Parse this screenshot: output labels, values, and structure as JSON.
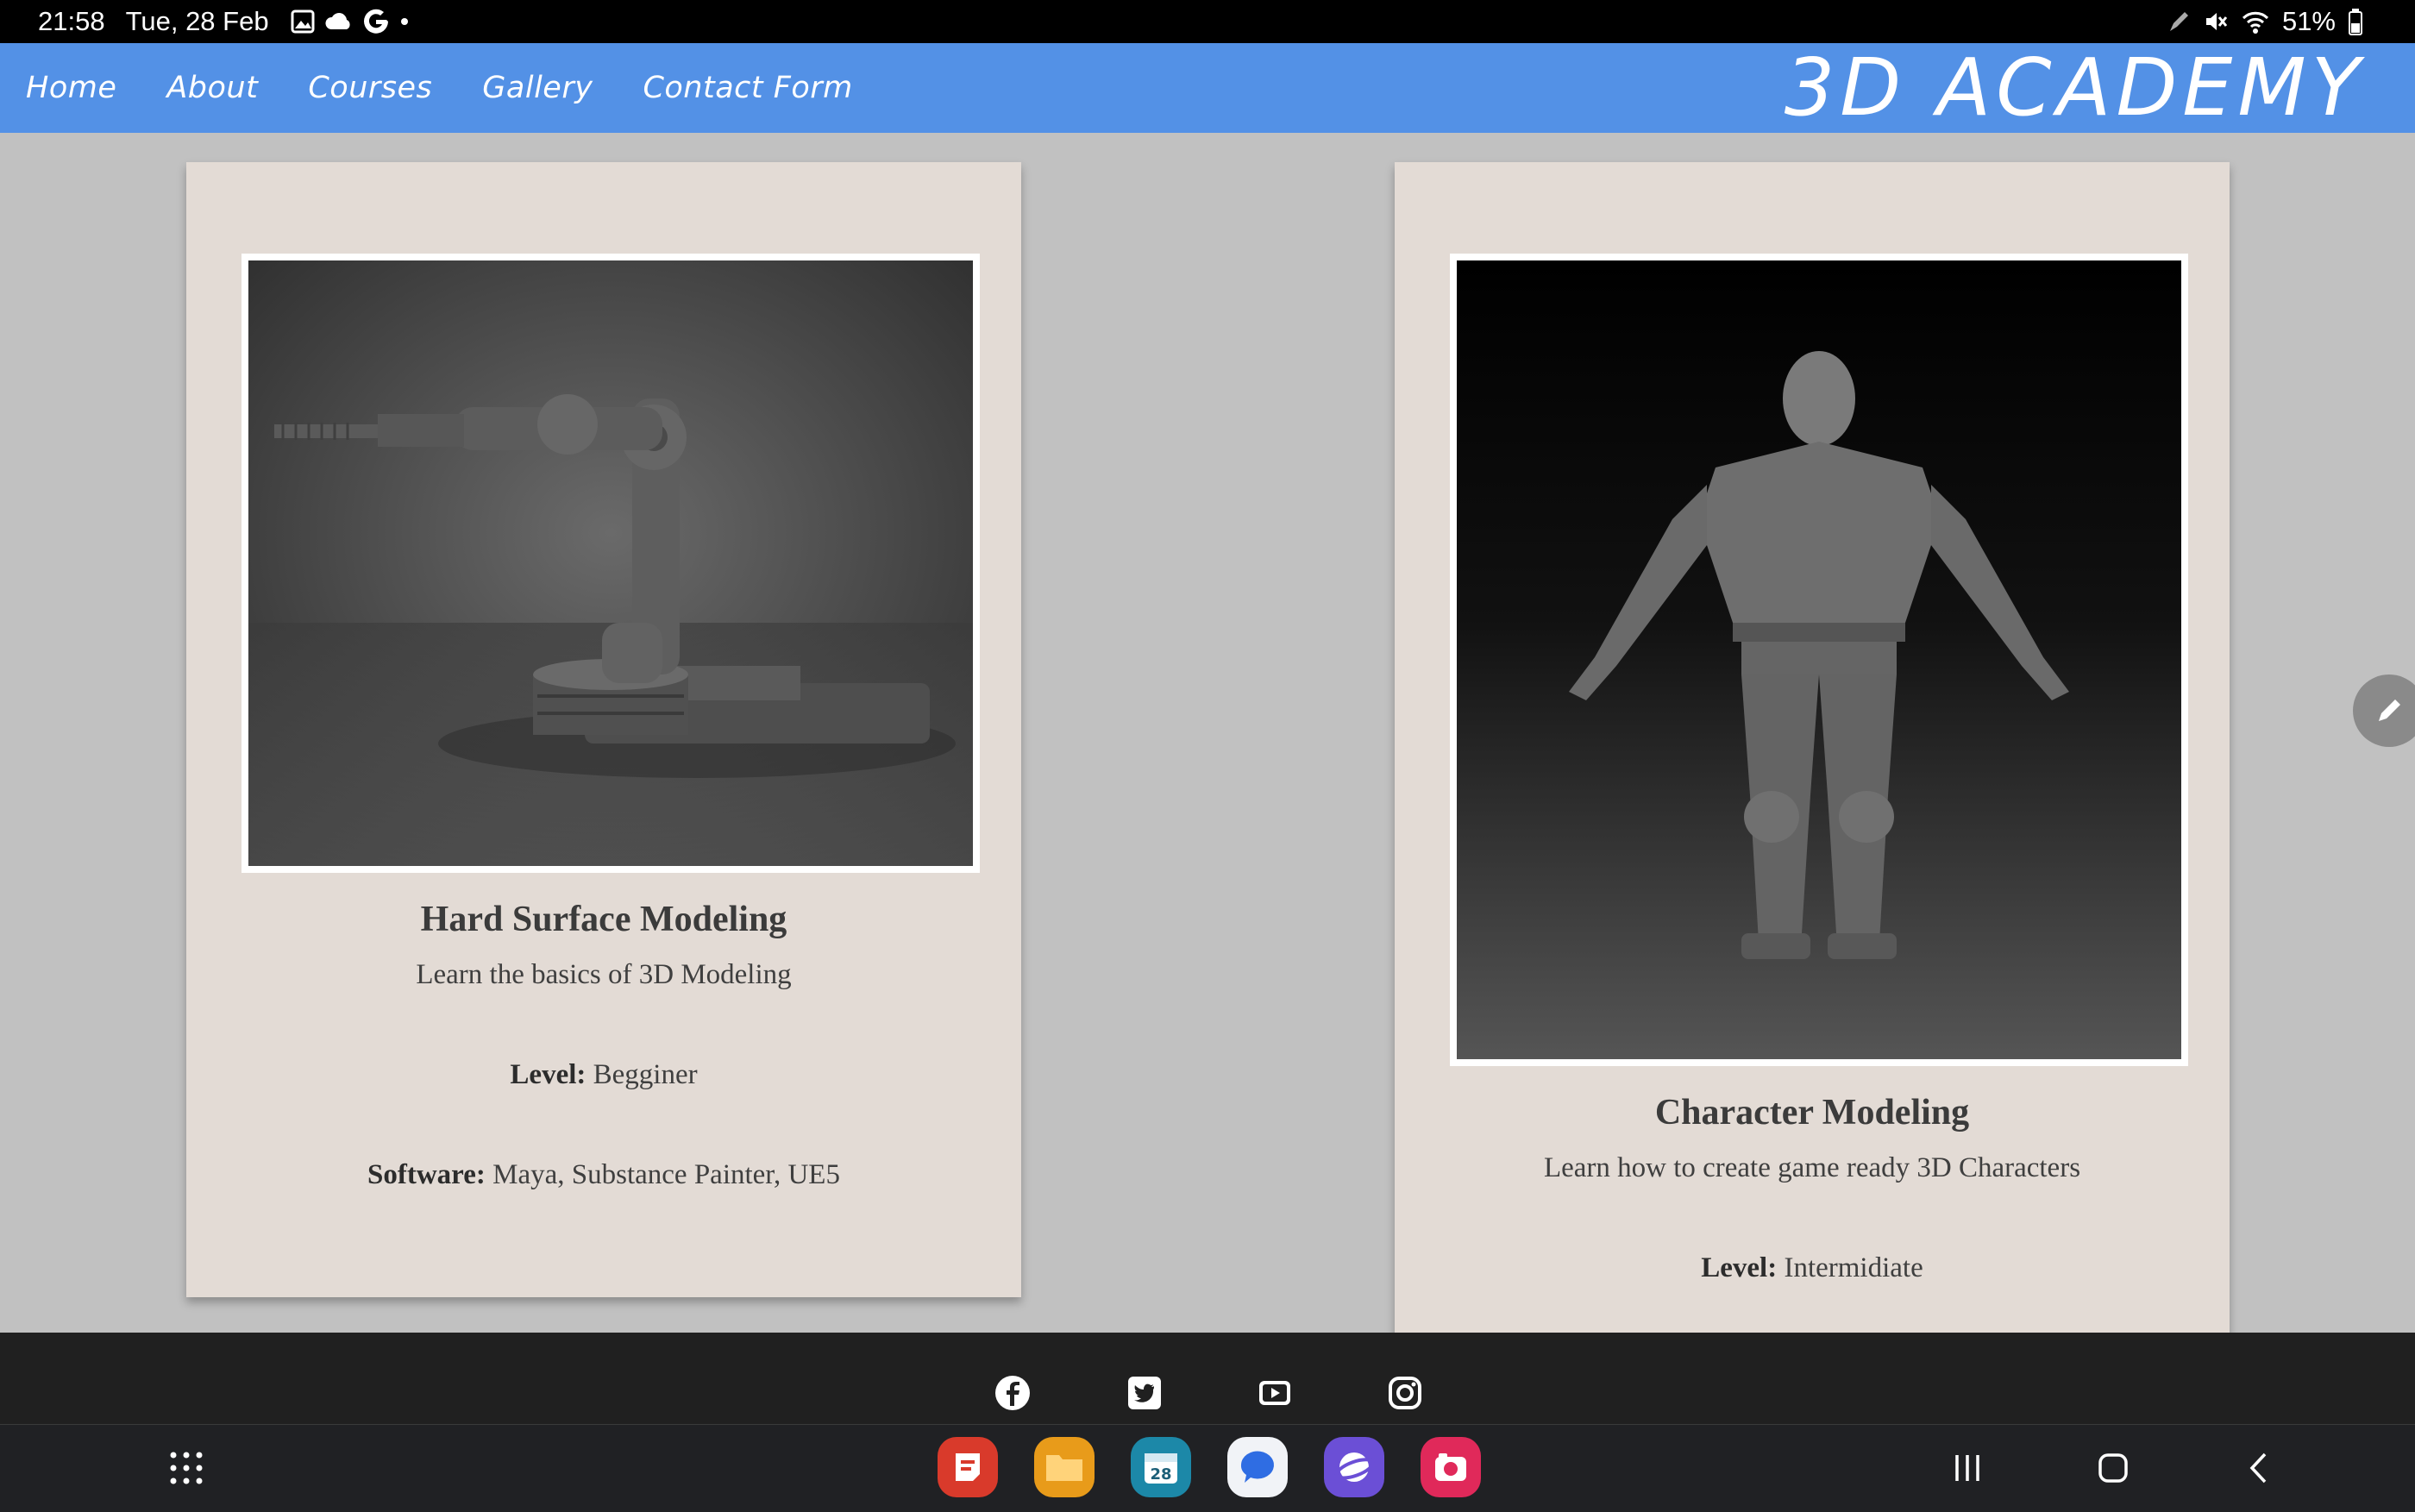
{
  "status_bar": {
    "time": "21:58",
    "date": "Tue, 28 Feb",
    "left_icons": [
      "gallery-icon",
      "cloud-icon",
      "google-icon",
      "dot-icon"
    ],
    "right_icons": [
      "pen-icon",
      "mute-icon",
      "wifi-icon"
    ],
    "battery": "51%"
  },
  "nav": {
    "links": [
      "Home",
      "About",
      "Courses",
      "Gallery",
      "Contact Form"
    ],
    "brand": "3D ACADEMY"
  },
  "cards": [
    {
      "title": "Hard Surface Modeling",
      "description": "Learn the basics of 3D Modeling",
      "level_label": "Level:",
      "level": "Begginer",
      "software_label": "Software:",
      "software": "Maya, Substance Painter, UE5",
      "image": "robotic-arm-render"
    },
    {
      "title": "Character Modeling",
      "description": "Learn how to create game ready 3D Characters",
      "level_label": "Level:",
      "level": "Intermidiate",
      "image": "armored-orc-sculpt"
    }
  ],
  "footer": {
    "social_icons": [
      "facebook-icon",
      "twitter-icon",
      "youtube-icon",
      "instagram-icon"
    ]
  },
  "dock": {
    "apps": [
      "samsung-notes-icon",
      "my-files-icon",
      "calendar-icon",
      "messages-icon",
      "samsung-internet-icon",
      "screen-recorder-icon"
    ],
    "calendar_day": "28"
  },
  "colors": {
    "nav_bg": "#5391e6",
    "page_bg": "#c1c1c1",
    "card_bg": "#e3dbd5",
    "footer_bg": "#202020"
  }
}
